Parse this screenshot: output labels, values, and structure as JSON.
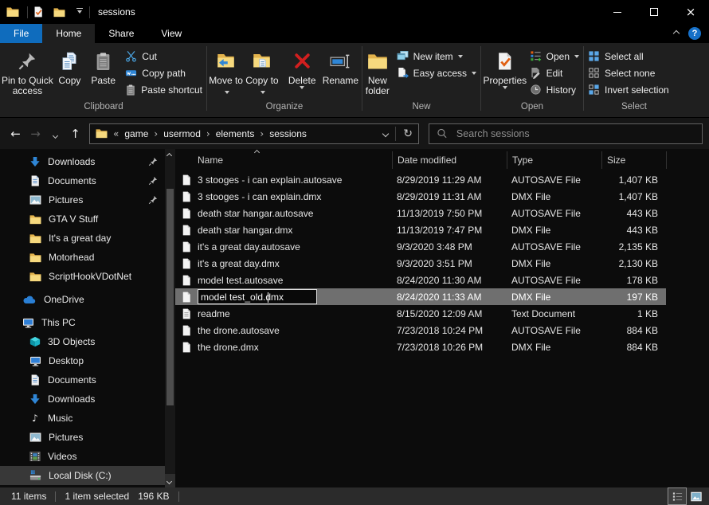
{
  "window": {
    "title": "sessions"
  },
  "tabs": [
    {
      "label": "File"
    },
    {
      "label": "Home"
    },
    {
      "label": "Share"
    },
    {
      "label": "View"
    }
  ],
  "ribbon": {
    "clipboard": {
      "label": "Clipboard",
      "pin": "Pin to Quick access",
      "copy": "Copy",
      "paste": "Paste",
      "cut": "Cut",
      "copy_path": "Copy path",
      "paste_shortcut": "Paste shortcut"
    },
    "organize": {
      "label": "Organize",
      "move_to": "Move to",
      "copy_to": "Copy to",
      "delete": "Delete",
      "rename": "Rename"
    },
    "new": {
      "label": "New",
      "new_folder": "New folder",
      "new_item": "New item",
      "easy_access": "Easy access"
    },
    "open": {
      "label": "Open",
      "properties": "Properties",
      "open": "Open",
      "edit": "Edit",
      "history": "History"
    },
    "select": {
      "label": "Select",
      "select_all": "Select all",
      "select_none": "Select none",
      "invert_selection": "Invert selection"
    }
  },
  "addressbar": {
    "overflow": "«",
    "separator": "›",
    "crumbs": [
      "game",
      "usermod",
      "elements",
      "sessions"
    ],
    "back": "←",
    "forward": "→",
    "up": "↑",
    "refresh": "↻"
  },
  "search": {
    "placeholder": "Search sessions"
  },
  "sidebar": {
    "items": [
      {
        "label": "Downloads",
        "icon": "download-arrow",
        "pinned": true
      },
      {
        "label": "Documents",
        "icon": "document",
        "pinned": true
      },
      {
        "label": "Pictures",
        "icon": "picture",
        "pinned": true
      },
      {
        "label": "GTA V Stuff",
        "icon": "folder"
      },
      {
        "label": "It's a great day",
        "icon": "folder"
      },
      {
        "label": "Motorhead",
        "icon": "folder"
      },
      {
        "label": "ScriptHookVDotNet",
        "icon": "folder"
      },
      {
        "label": "OneDrive",
        "icon": "onedrive-cloud"
      },
      {
        "label": "This PC",
        "icon": "computer"
      },
      {
        "label": "3D Objects",
        "icon": "cube-3d"
      },
      {
        "label": "Desktop",
        "icon": "monitor"
      },
      {
        "label": "Documents",
        "icon": "document"
      },
      {
        "label": "Downloads",
        "icon": "download-arrow"
      },
      {
        "label": "Music",
        "icon": "music-note",
        "glyph": "♪"
      },
      {
        "label": "Pictures",
        "icon": "picture"
      },
      {
        "label": "Videos",
        "icon": "film"
      },
      {
        "label": "Local Disk (C:)",
        "icon": "hard-disk",
        "highlighted": true
      }
    ]
  },
  "files": {
    "columns": [
      "Name",
      "Date modified",
      "Type",
      "Size"
    ],
    "rows": [
      {
        "name": "3 stooges - i can explain.autosave",
        "date": "8/29/2019 11:29 AM",
        "type": "AUTOSAVE File",
        "size": "1,407 KB",
        "icon": "file"
      },
      {
        "name": "3 stooges - i can explain.dmx",
        "date": "8/29/2019 11:31 AM",
        "type": "DMX File",
        "size": "1,407 KB",
        "icon": "file"
      },
      {
        "name": "death star hangar.autosave",
        "date": "11/13/2019 7:50 PM",
        "type": "AUTOSAVE File",
        "size": "443 KB",
        "icon": "file"
      },
      {
        "name": "death star hangar.dmx",
        "date": "11/13/2019 7:47 PM",
        "type": "DMX File",
        "size": "443 KB",
        "icon": "file"
      },
      {
        "name": "it's a great day.autosave",
        "date": "9/3/2020 3:48 PM",
        "type": "AUTOSAVE File",
        "size": "2,135 KB",
        "icon": "file"
      },
      {
        "name": "it's a great day.dmx",
        "date": "9/3/2020 3:51 PM",
        "type": "DMX File",
        "size": "2,130 KB",
        "icon": "file"
      },
      {
        "name": "model test.autosave",
        "date": "8/24/2020 11:30 AM",
        "type": "AUTOSAVE File",
        "size": "178 KB",
        "icon": "file"
      },
      {
        "name": "model test_old.dmx",
        "date": "8/24/2020 11:33 AM",
        "type": "DMX File",
        "size": "197 KB",
        "icon": "file",
        "selected": true,
        "renaming": true
      },
      {
        "name": "readme",
        "date": "8/15/2020 12:09 AM",
        "type": "Text Document",
        "size": "1 KB",
        "icon": "text-file"
      },
      {
        "name": "the drone.autosave",
        "date": "7/23/2018 10:24 PM",
        "type": "AUTOSAVE File",
        "size": "884 KB",
        "icon": "file"
      },
      {
        "name": "the drone.dmx",
        "date": "7/23/2018 10:26 PM",
        "type": "DMX File",
        "size": "884 KB",
        "icon": "file"
      }
    ]
  },
  "rename": {
    "value": "model test_old.dmx"
  },
  "statusbar": {
    "items_count": "11 items",
    "selection": "1 item selected",
    "selection_size": "196 KB"
  },
  "icons": {
    "help_glyph": "?"
  },
  "colors": {
    "accent_blue": "#0f6cbd",
    "selection_gray": "#6f6f6f",
    "folder_yellow": "#f6d97e",
    "delete_red": "#d21f1f",
    "item_blue": "#2f86d6",
    "status_bg": "#2b2b2b"
  }
}
